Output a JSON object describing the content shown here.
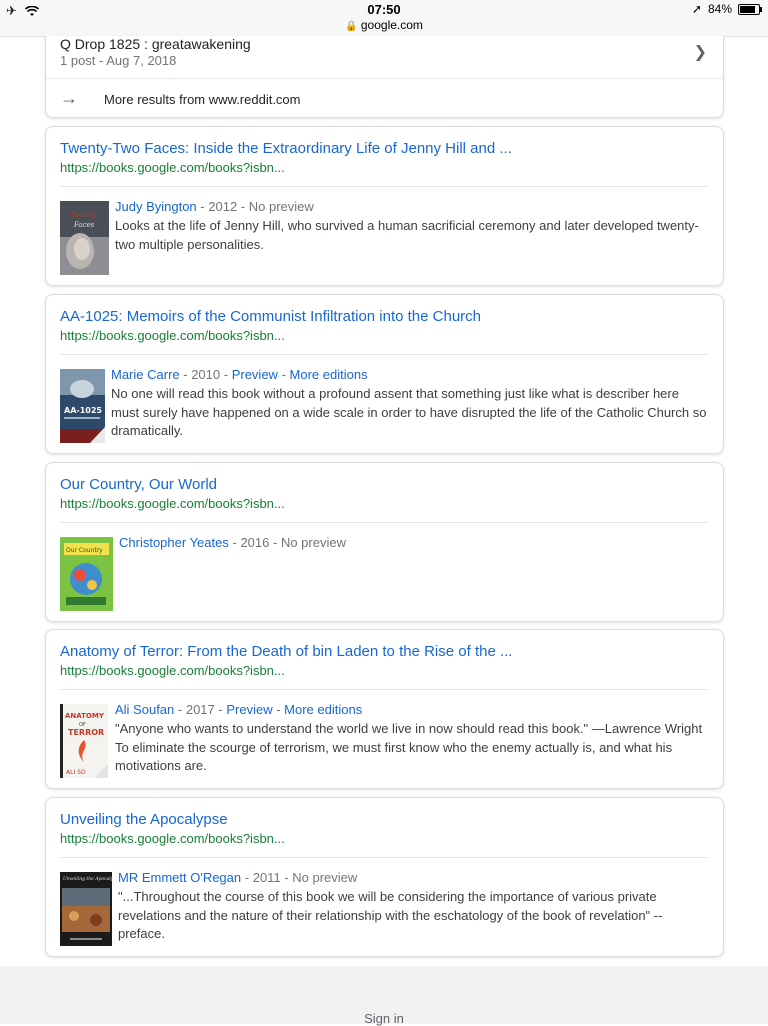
{
  "status": {
    "time": "07:50",
    "url": "google.com",
    "battery": "84%",
    "battery_level": 0.84
  },
  "reddit": {
    "title": "Q Drop 1825 : greatawakening",
    "meta": "1 post - Aug 7, 2018",
    "more": "More results from www.reddit.com"
  },
  "results": [
    {
      "title": "Twenty-Two Faces: Inside the Extraordinary Life of Jenny Hill and ...",
      "url": "https://books.google.com/books?isbn...",
      "author": "Judy Byington",
      "year": "2012",
      "preview": "No preview",
      "editions": "",
      "snippet": "Looks at the life of Jenny Hill, who survived a human sacrificial ceremony and later developed twenty-two multiple personalities."
    },
    {
      "title": "AA-1025: Memoirs of the Communist Infiltration into the Church",
      "url": "https://books.google.com/books?isbn...",
      "author": "Marie Carre",
      "year": "2010",
      "preview": "Preview",
      "editions": "More editions",
      "snippet": "No one will read this book without a profound assent that something just like what is describer here must surely have happened on a wide scale in order to have disrupted the life of the Catholic Church so dramatically."
    },
    {
      "title": "Our Country, Our World",
      "url": "https://books.google.com/books?isbn...",
      "author": "Christopher Yeates",
      "year": "2016",
      "preview": "No preview",
      "editions": "",
      "snippet": ""
    },
    {
      "title": "Anatomy of Terror: From the Death of bin Laden to the Rise of the ...",
      "url": "https://books.google.com/books?isbn...",
      "author": "Ali Soufan",
      "year": "2017",
      "preview": "Preview",
      "editions": "More editions",
      "snippet": "\"Anyone who wants to understand the world we live in now should read this book.\" —Lawrence Wright To eliminate the scourge of terrorism, we must first know who the enemy actually is, and what his motivations are."
    },
    {
      "title": "Unveiling the Apocalypse",
      "url": "https://books.google.com/books?isbn...",
      "author": "MR Emmett O'Regan",
      "year": "2011",
      "preview": "No preview",
      "editions": "",
      "snippet": "\"...Throughout the course of this book we will be considering the importance of various private revelations and the nature of their relationship with the eschatology of the book of revelation\" --preface."
    }
  ],
  "footer": {
    "signin": "Sign in"
  },
  "colors": {
    "link": "#1967d2",
    "url": "#188038",
    "meta": "#70757a"
  }
}
